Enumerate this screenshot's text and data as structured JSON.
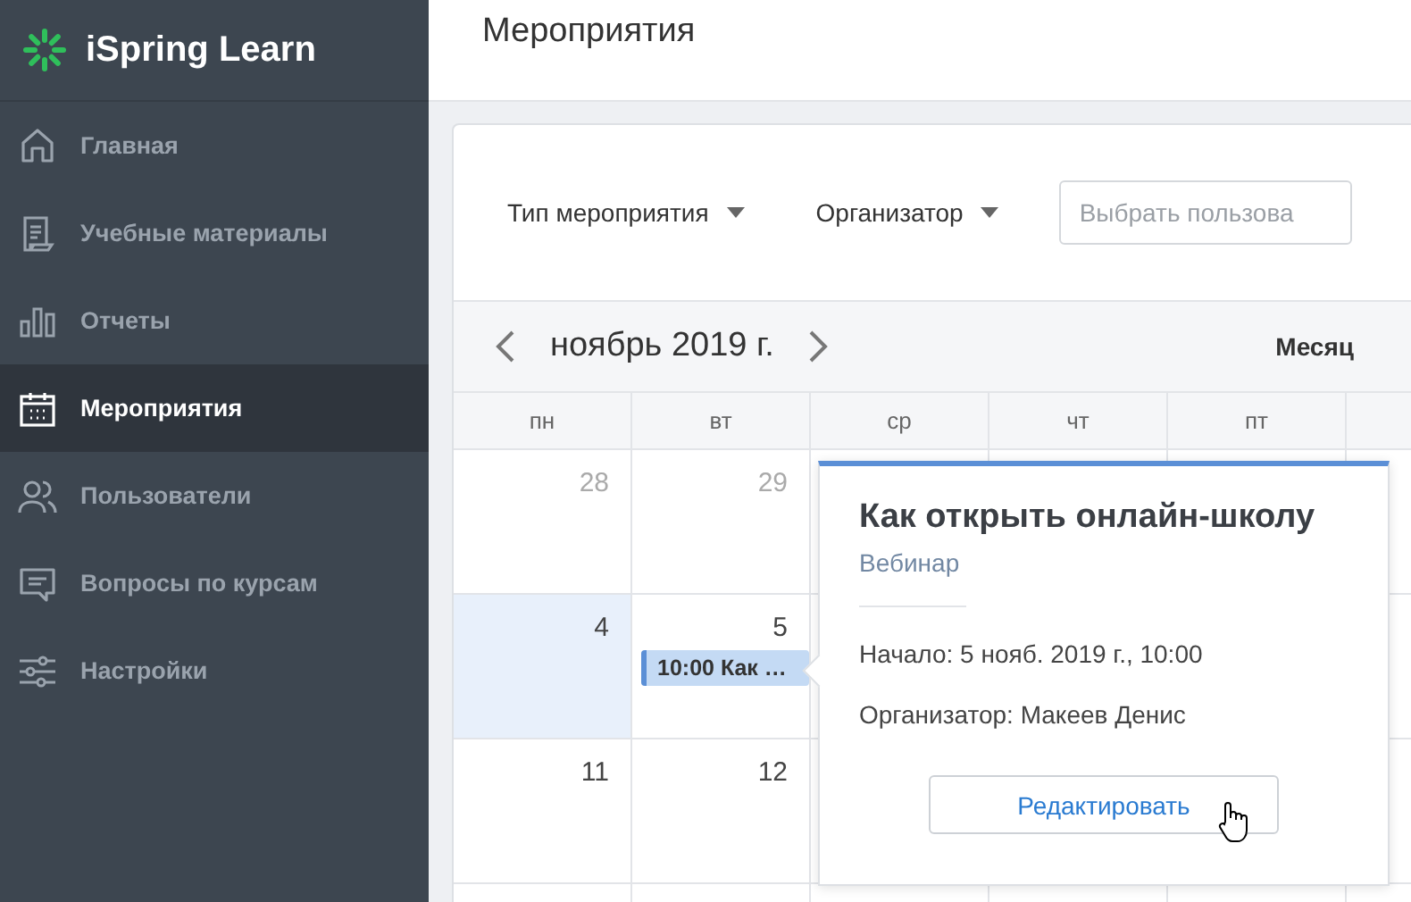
{
  "sidebar": {
    "logo": "iSpring Learn",
    "items": [
      {
        "label": "Главная",
        "selected": false
      },
      {
        "label": "Учебные материалы",
        "selected": false
      },
      {
        "label": "Отчеты",
        "selected": false
      },
      {
        "label": "Мероприятия",
        "selected": true
      },
      {
        "label": "Пользователи",
        "selected": false
      },
      {
        "label": "Вопросы по курсам",
        "selected": false
      },
      {
        "label": "Настройки",
        "selected": false
      }
    ]
  },
  "header": {
    "title": "Мероприятия"
  },
  "filters": {
    "dropdowns": [
      "Тип мероприятия",
      "Организатор"
    ],
    "user_field": {
      "placeholder": "Выбрать пользова"
    }
  },
  "calendar": {
    "month": "ноябрь 2019 г.",
    "view": "Месяц",
    "weekdays": [
      "пн",
      "вт",
      "ср",
      "чт",
      "пт"
    ],
    "weeks": [
      {
        "days": [
          {
            "label": "28",
            "other_month": true,
            "selected": false
          },
          {
            "label": "29",
            "other_month": true,
            "selected": false
          }
        ]
      },
      {
        "days": [
          {
            "label": "4",
            "other_month": false,
            "selected": true
          },
          {
            "label": "5",
            "other_month": false,
            "selected": false,
            "events": [
              "10:00 Как …"
            ]
          }
        ]
      },
      {
        "days": [
          {
            "label": "11",
            "other_month": false,
            "selected": false
          },
          {
            "label": "12",
            "other_month": false,
            "selected": false
          }
        ]
      }
    ]
  },
  "popover": {
    "title": "Как открыть онлайн-школу",
    "type": "Вебинар",
    "start": "Начало: 5 нояб. 2019 г., 10:00",
    "organizer": "Организатор: Макеев Денис",
    "button": "Редактировать"
  }
}
